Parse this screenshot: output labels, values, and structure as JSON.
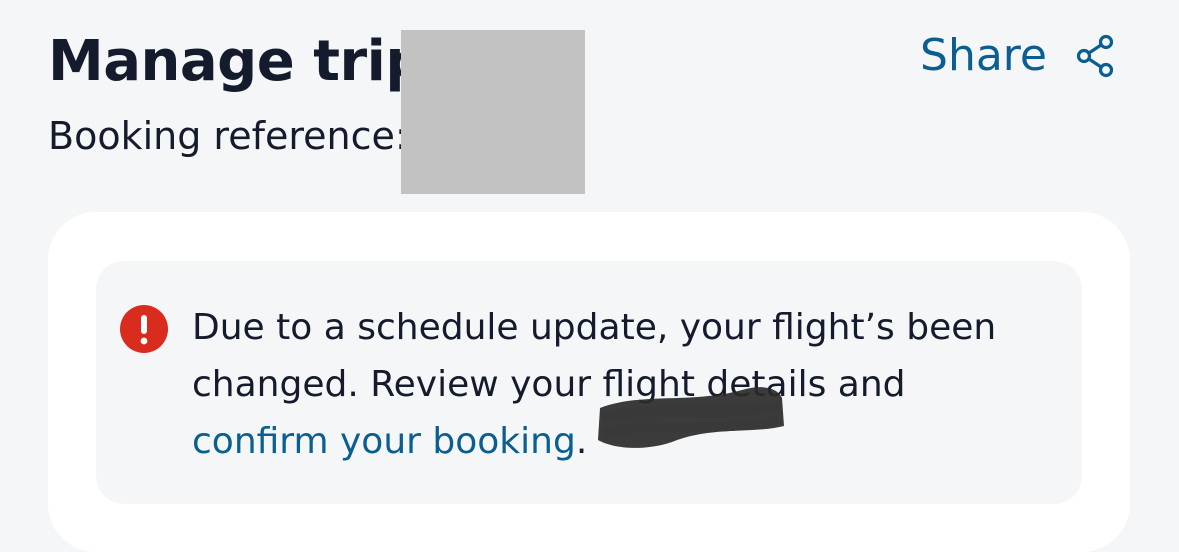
{
  "header": {
    "title": "Manage trip",
    "booking_reference_label": "Booking reference:"
  },
  "share": {
    "label": "Share",
    "icon": "share-icon"
  },
  "alert": {
    "icon": "exclamation-circle-icon",
    "text": "Due to a schedule update, your flight’s been changed. Review your flight details and ",
    "link_text": "confirm your booking",
    "trailing": "."
  },
  "colors": {
    "background": "#f5f6f8",
    "text": "#141b2c",
    "link": "#0a5f90",
    "alert_icon": "#d92b1e",
    "card": "#ffffff",
    "redaction": "#c2c2c2"
  }
}
